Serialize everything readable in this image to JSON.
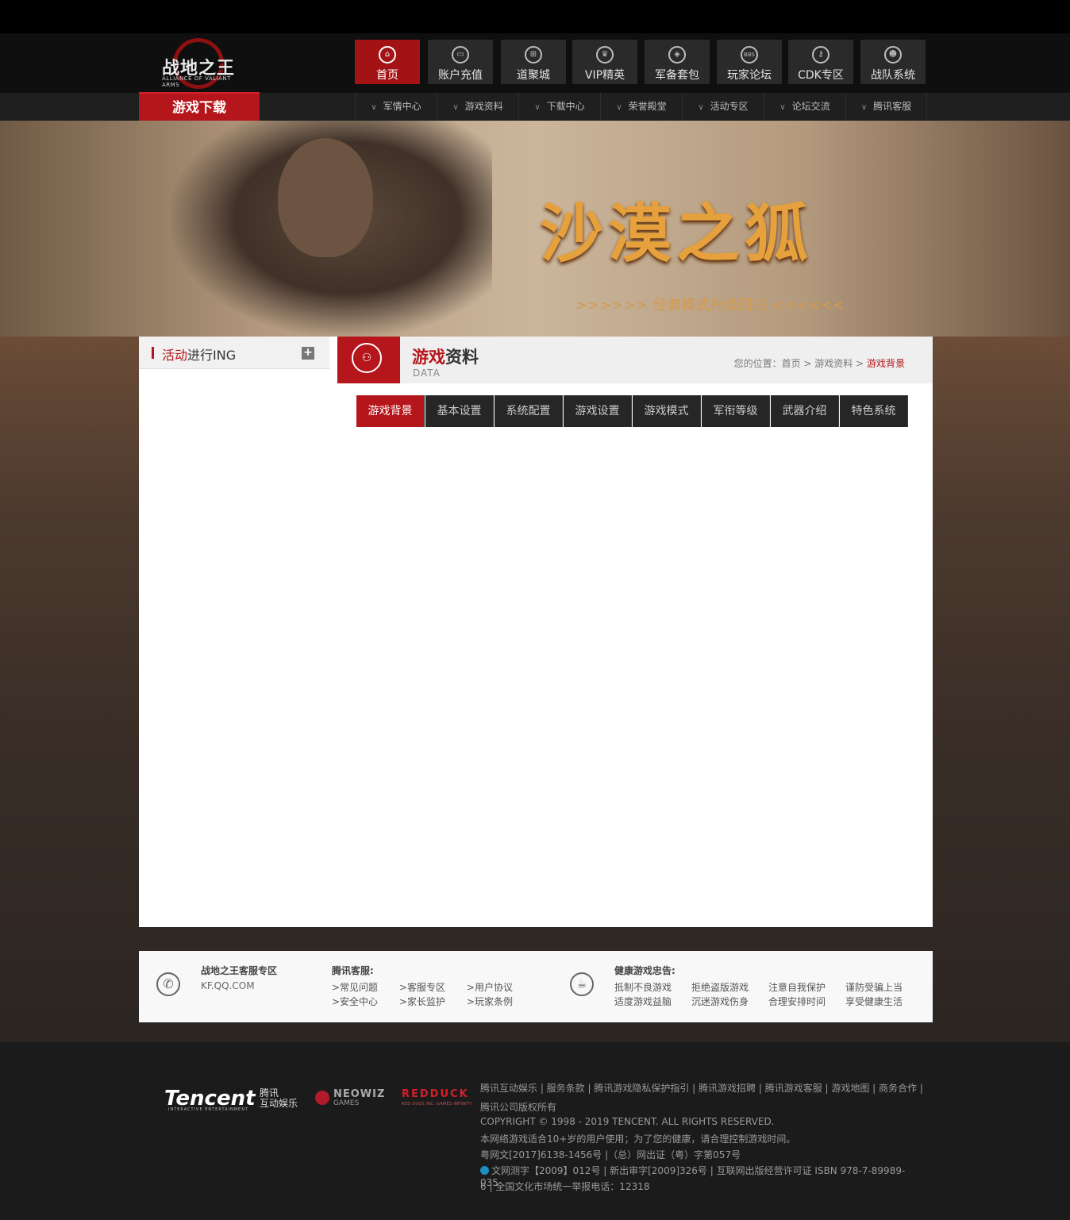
{
  "header": {
    "logo_text": "战地之王",
    "logo_subtext": "ALLIANCE OF VALIANT ARMS",
    "download_label": "游戏下载"
  },
  "main_nav": [
    {
      "label": "首页",
      "icon": "home-icon",
      "active": true
    },
    {
      "label": "账户充值",
      "icon": "wallet-icon",
      "active": false
    },
    {
      "label": "道聚城",
      "icon": "cart-icon",
      "active": false
    },
    {
      "label": "VIP精英",
      "icon": "medal-icon",
      "active": false
    },
    {
      "label": "军备套包",
      "icon": "shield-icon",
      "active": false
    },
    {
      "label": "玩家论坛",
      "icon": "bbs-icon",
      "active": false
    },
    {
      "label": "CDK专区",
      "icon": "key-icon",
      "active": false
    },
    {
      "label": "战队系统",
      "icon": "team-icon",
      "active": false
    }
  ],
  "sub_nav": [
    "军情中心",
    "游戏资料",
    "下载中心",
    "荣誉殿堂",
    "活动专区",
    "论坛交流",
    "腾讯客服"
  ],
  "hero": {
    "title": "沙漠之狐",
    "subtitle": ">>>>>>  经典模式升级回归  <<<<<<"
  },
  "sidebar": {
    "title_red": "活动",
    "title_rest": "进行ING",
    "plus": "+"
  },
  "section": {
    "title_red": "游戏",
    "title_rest": "资料",
    "subtitle": "DATA",
    "breadcrumb_prefix": "您的位置：首页 > 游戏资料 > ",
    "breadcrumb_current": "游戏背景"
  },
  "tabs": [
    {
      "label": "游戏背景",
      "active": true
    },
    {
      "label": "基本设置",
      "active": false
    },
    {
      "label": "系统配置",
      "active": false
    },
    {
      "label": "游戏设置",
      "active": false
    },
    {
      "label": "游戏模式",
      "active": false
    },
    {
      "label": "军衔等级",
      "active": false
    },
    {
      "label": "武器介绍",
      "active": false
    },
    {
      "label": "特色系统",
      "active": false
    }
  ],
  "service": {
    "zone_title": "战地之王客服专区",
    "zone_url": "KF.QQ.COM",
    "tencent_title": "腾讯客服:",
    "tencent_links": [
      ">常见问题",
      ">客服专区",
      ">用户协议",
      ">安全中心",
      ">家长监护",
      ">玩家条例"
    ],
    "health_title": "健康游戏忠告:",
    "health_items": [
      "抵制不良游戏",
      "拒绝盗版游戏",
      "注意自我保护",
      "谨防受骗上当",
      "适度游戏益脑",
      "沉迷游戏伤身",
      "合理安排时间",
      "享受健康生活"
    ]
  },
  "footer": {
    "tencent_logo": "Tencent",
    "tencent_logo_sub": "INTERACTIVE ENTERTAINMENT",
    "tencent_cn_1": "腾讯",
    "tencent_cn_2": "互动娱乐",
    "neowiz": "NEOWIZ",
    "neowiz_sub": "GAMES",
    "redduck": "REDDUCK",
    "redduck_sub": "RED DUCK INC. GAMES INFINITY",
    "links": "腾讯互动娱乐 | 服务条款 | 腾讯游戏隐私保护指引 | 腾讯游戏招聘 | 腾讯游戏客服 | 游戏地图 | 商务合作 | 腾讯",
    "copyright_cn": "腾讯公司版权所有",
    "copyright_en": "COPYRIGHT © 1998 - 2019 TENCENT. ALL RIGHTS RESERVED.",
    "age_notice": "本网络游戏适合10+岁的用户使用；为了您的健康，请合理控制游戏时间。",
    "license_1": "粤网文[2017]6138-1456号 |（总）网出证（粤）字第057号",
    "license_2": "文网测字【2009】012号 | 新出审字[2009]326号 | 互联网出版经营许可证 ISBN 978-7-89989-035-",
    "license_3": "6 | 全国文化市场统一举报电话：12318"
  }
}
